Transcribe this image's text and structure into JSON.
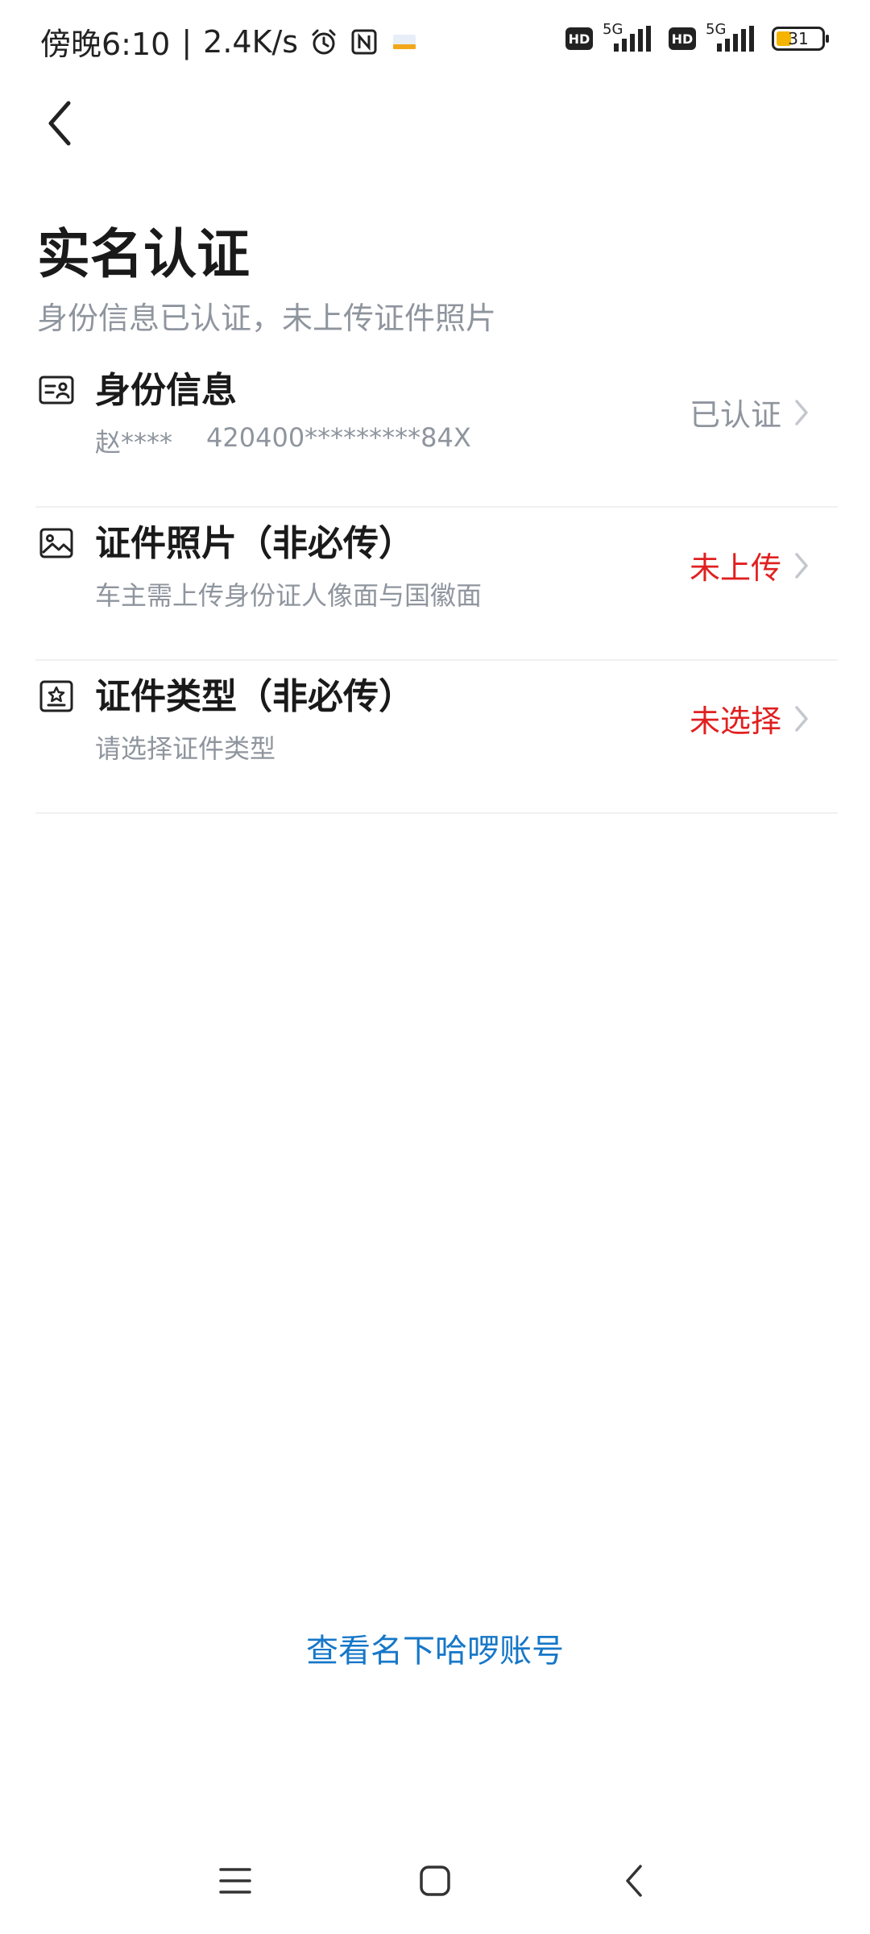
{
  "status_bar": {
    "time": "傍晚6:10",
    "separator": "|",
    "network_speed": "2.4K/s",
    "icons_left": [
      "alarm-icon",
      "nfc-icon",
      "notification-app-icon"
    ],
    "signal_1": {
      "hd": "HD",
      "tech": "5G"
    },
    "signal_2": {
      "hd": "HD",
      "tech": "5G"
    },
    "battery": "31",
    "battery_color": "#f4b400"
  },
  "header": {
    "back_icon": "chevron-left-icon",
    "title": "实名认证",
    "subtitle": "身份信息已认证，未上传证件照片"
  },
  "items": [
    {
      "icon": "id-card-icon",
      "title": "身份信息",
      "subtitle_name": "赵****",
      "subtitle_id": "420400*********84X",
      "status": "已认证",
      "status_color": "#8f959e"
    },
    {
      "icon": "image-icon",
      "title": "证件照片（非必传）",
      "subtitle": "车主需上传身份证人像面与国徽面",
      "status": "未上传",
      "status_color": "#e02020"
    },
    {
      "icon": "badge-star-icon",
      "title": "证件类型（非必传）",
      "subtitle": "请选择证件类型",
      "status": "未选择",
      "status_color": "#e02020"
    }
  ],
  "footer": {
    "link_text": "查看名下哈啰账号",
    "link_color": "#1677c8"
  },
  "nav_bar": {
    "icons": [
      "menu-icon",
      "home-square-icon",
      "back-triangle-icon"
    ]
  }
}
